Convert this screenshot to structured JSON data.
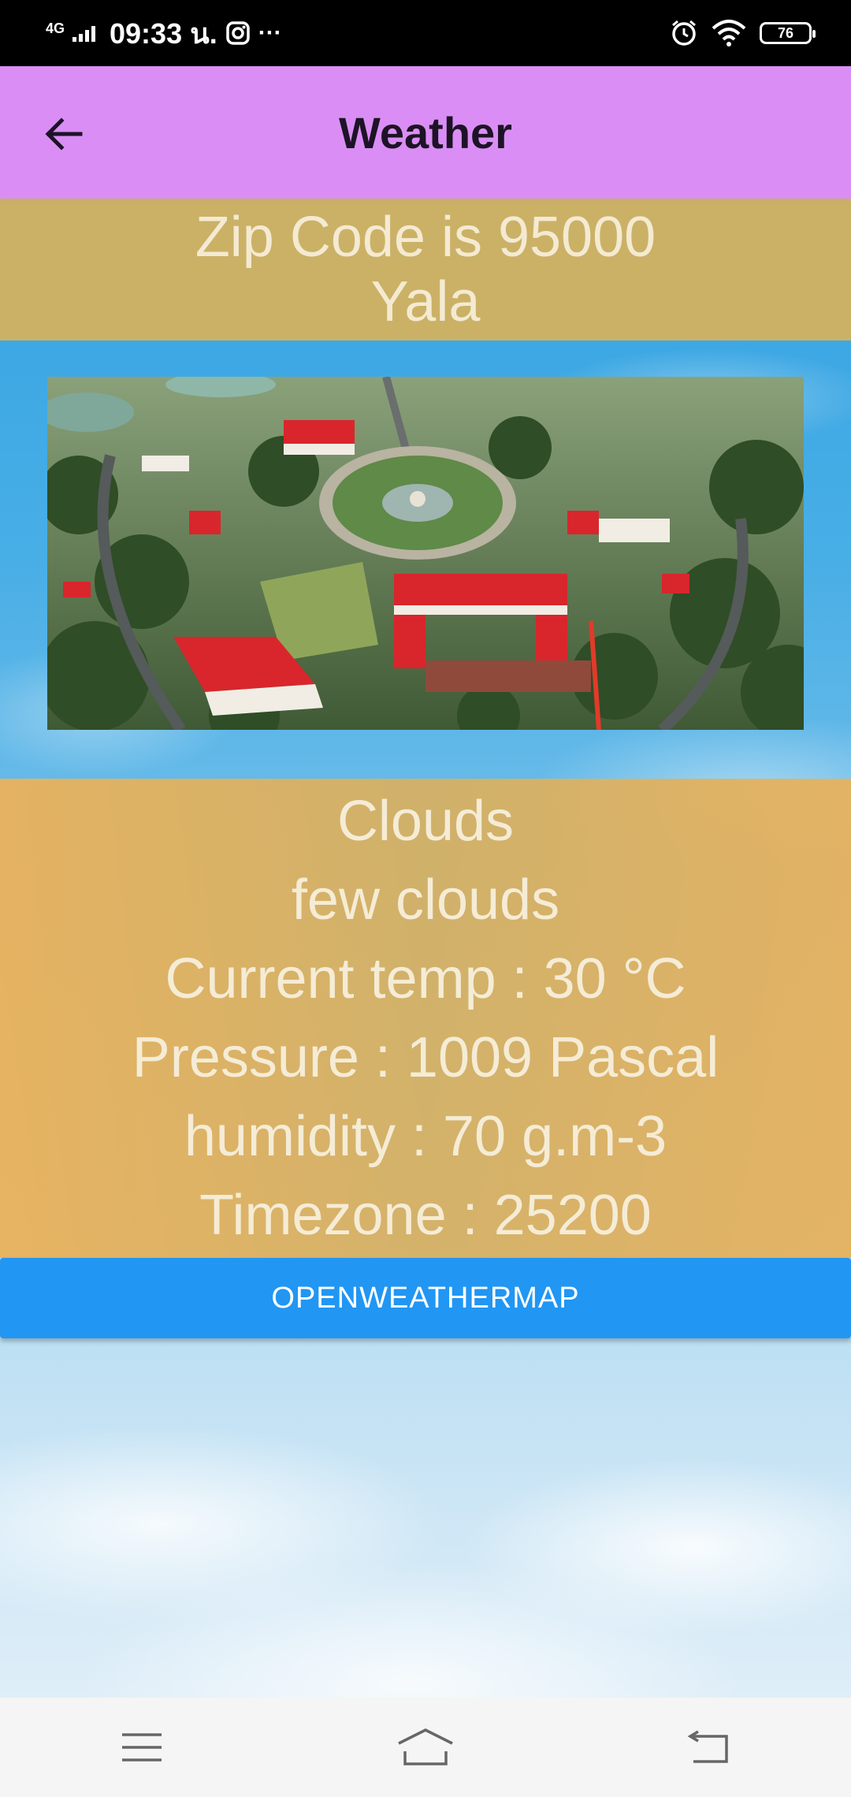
{
  "status_bar": {
    "network": "4G",
    "time": "09:33 น.",
    "more": "···",
    "battery": "76"
  },
  "app_bar": {
    "title": "Weather"
  },
  "location": {
    "zip_line": "Zip Code is 95000",
    "city": "Yala"
  },
  "weather": {
    "main": "Clouds",
    "description": "few clouds",
    "temp": "Current temp : 30 °C",
    "pressure": "Pressure : 1009 Pascal",
    "humidity": "humidity : 70 g.m-3",
    "timezone": "Timezone : 25200"
  },
  "button": {
    "label": "OPENWEATHERMAP",
    "color": "#2196f3"
  },
  "colors": {
    "app_bar": "#da8ef5",
    "panel": "#d6b15c"
  },
  "icons": [
    "back-arrow-icon",
    "instagram-icon",
    "alarm-icon",
    "wifi-icon",
    "battery-icon",
    "menu-icon",
    "home-icon",
    "back-icon"
  ]
}
